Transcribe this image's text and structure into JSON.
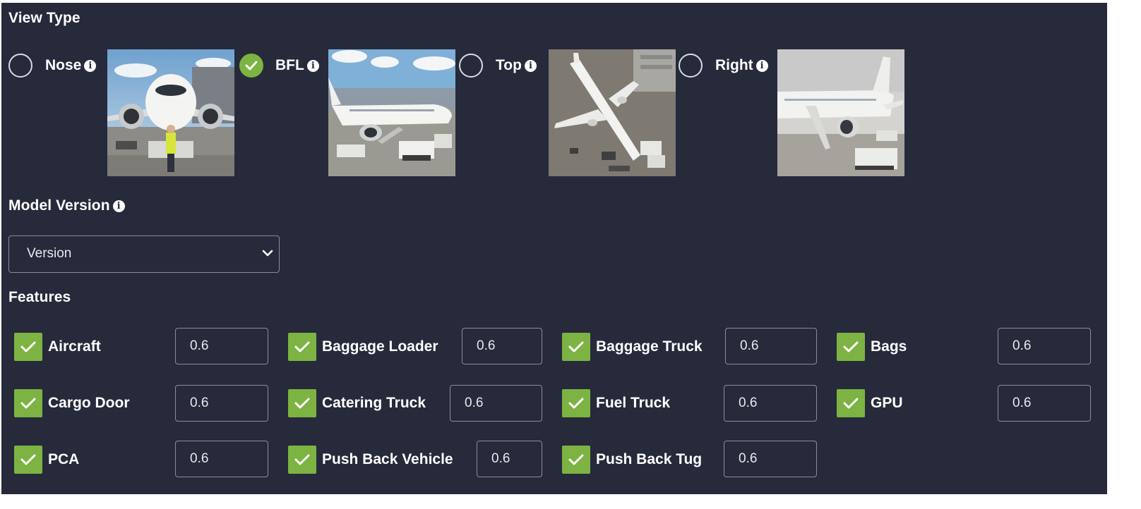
{
  "view_type": {
    "title": "View Type",
    "options": [
      {
        "label": "Nose",
        "selected": false,
        "image": "aircraft-nose-view-photo"
      },
      {
        "label": "BFL",
        "selected": true,
        "image": "aircraft-bfl-view-photo"
      },
      {
        "label": "Top",
        "selected": false,
        "image": "aircraft-top-view-photo"
      },
      {
        "label": "Right",
        "selected": false,
        "image": "aircraft-right-view-photo"
      }
    ]
  },
  "model_version": {
    "title": "Model Version",
    "select_value": "Version"
  },
  "features": {
    "title": "Features",
    "items": [
      {
        "label": "Aircraft",
        "checked": true,
        "value": "0.6"
      },
      {
        "label": "Baggage Loader",
        "checked": true,
        "value": "0.6"
      },
      {
        "label": "Baggage Truck",
        "checked": true,
        "value": "0.6"
      },
      {
        "label": "Bags",
        "checked": true,
        "value": "0.6"
      },
      {
        "label": "Cargo Door",
        "checked": true,
        "value": "0.6"
      },
      {
        "label": "Catering Truck",
        "checked": true,
        "value": "0.6"
      },
      {
        "label": "Fuel Truck",
        "checked": true,
        "value": "0.6"
      },
      {
        "label": "GPU",
        "checked": true,
        "value": "0.6"
      },
      {
        "label": "PCA",
        "checked": true,
        "value": "0.6"
      },
      {
        "label": "Push Back Vehicle",
        "checked": true,
        "value": "0.6"
      },
      {
        "label": "Push Back Tug",
        "checked": true,
        "value": "0.6"
      }
    ]
  },
  "colors": {
    "panel_background": "#262a3b",
    "accent_green": "#7cb342",
    "text": "#ffffff",
    "input_border": "#8a8d99"
  },
  "icons": {
    "info": "info-icon",
    "check": "check-icon",
    "chevron": "chevron-down-icon"
  }
}
